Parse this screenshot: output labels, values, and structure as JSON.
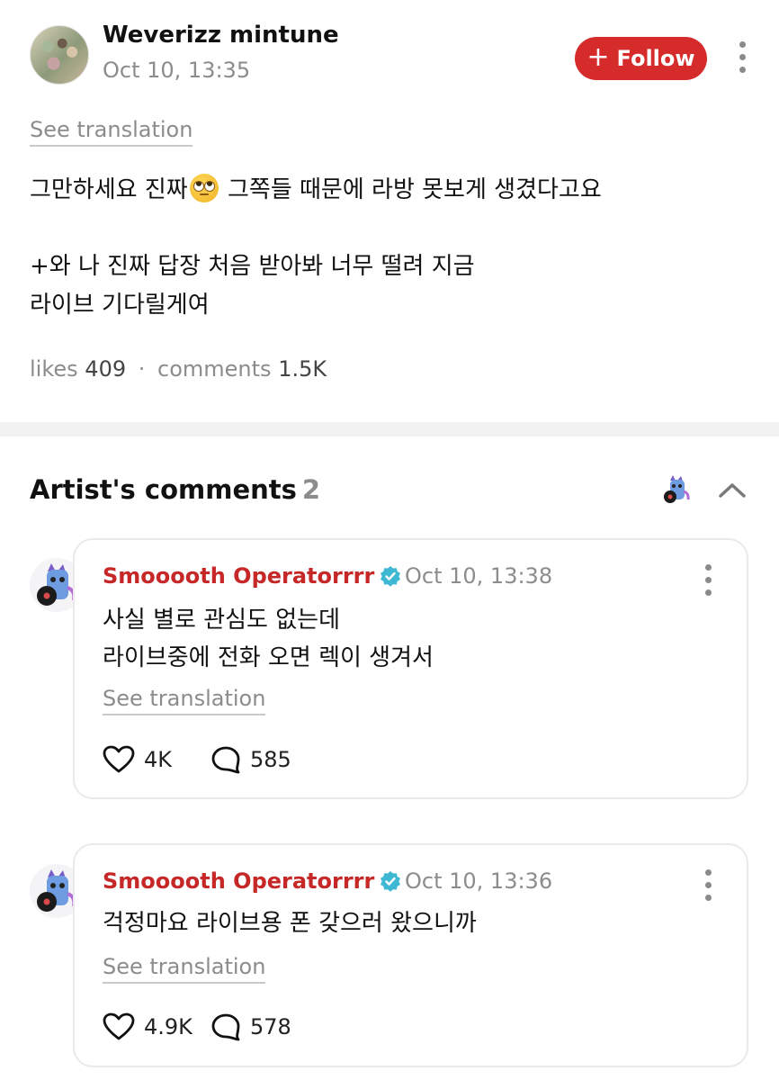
{
  "post": {
    "author": "Weverizz mintune",
    "time": "Oct 10, 13:35",
    "follow_label": "Follow",
    "see_translation": "See translation",
    "body_line_1a": "그만하세요 진짜",
    "body_line_1b": "그쪽들 때문에 라방 못보게 생겼다고요",
    "body_line_2": "+와 나 진짜 답장 처음 받아봐 너무 떨려 지금",
    "body_line_3": "라이브 기다릴게여",
    "likes_label": "likes",
    "likes_count": "409",
    "separator": "·",
    "comments_label": "comments",
    "comments_count": "1.5K"
  },
  "artist_comments": {
    "title": "Artist's comments",
    "count": "2"
  },
  "comments": [
    {
      "author": "Smooooth Operatorrrr",
      "time": "Oct 10, 13:38",
      "line_1": "사실 별로 관심도 없는데",
      "line_2": "라이브중에 전화 오면 렉이 생겨서",
      "see_translation": "See translation",
      "likes": "4K",
      "replies": "585"
    },
    {
      "author": "Smooooth Operatorrrr",
      "time": "Oct 10, 13:36",
      "line_1": "걱정마요 라이브용 폰 갖으러 왔으니까",
      "see_translation": "See translation",
      "likes": "4.9K",
      "replies": "578"
    }
  ],
  "colors": {
    "accent_red": "#d62b2b",
    "artist_name_red": "#c62828",
    "verified_blue": "#3fb8d4",
    "muted_gray": "#8c8c8c"
  },
  "icons": {
    "follow": "plus-icon",
    "more": "kebab-icon",
    "collapse": "chevron-up-icon",
    "like": "heart-icon",
    "reply": "speech-bubble-icon",
    "verified": "verified-badge-icon",
    "emoji": "face-with-rolling-eyes-emoji"
  }
}
